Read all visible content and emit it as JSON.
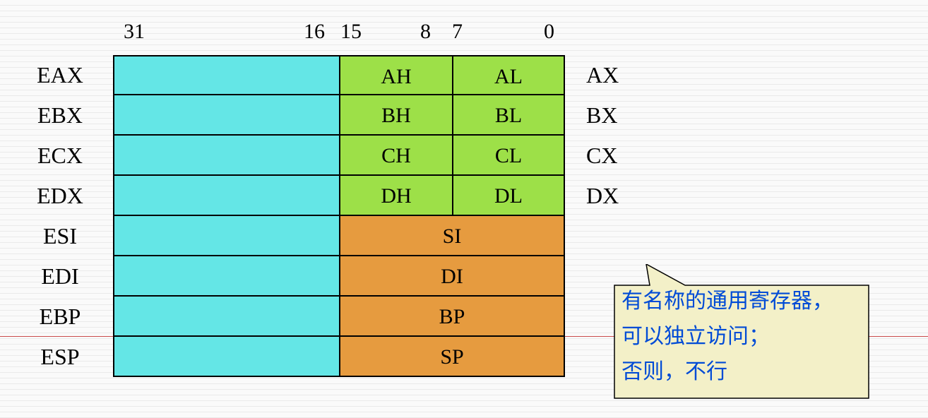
{
  "bits": {
    "b31": "31",
    "b16": "16",
    "b15": "15",
    "b8": "8",
    "b7": "7",
    "b0": "0"
  },
  "rows": [
    {
      "reg32": "EAX",
      "hi": "AH",
      "lo": "AL",
      "reg16": "AX"
    },
    {
      "reg32": "EBX",
      "hi": "BH",
      "lo": "BL",
      "reg16": "BX"
    },
    {
      "reg32": "ECX",
      "hi": "CH",
      "lo": "CL",
      "reg16": "CX"
    },
    {
      "reg32": "EDX",
      "hi": "DH",
      "lo": "DL",
      "reg16": "DX"
    },
    {
      "reg32": "ESI",
      "word": "SI"
    },
    {
      "reg32": "EDI",
      "word": "DI"
    },
    {
      "reg32": "EBP",
      "word": "BP"
    },
    {
      "reg32": "ESP",
      "word": "SP"
    }
  ],
  "callout": {
    "line1": "有名称的通用寄存器，",
    "line2": "可以独立访问；",
    "line3": "否则，不行"
  },
  "colors": {
    "cyan": "#64e6e6",
    "green": "#9de048",
    "orange": "#e69b3f",
    "calloutFill": "#f3f0c8",
    "calloutText": "#004bd6"
  }
}
